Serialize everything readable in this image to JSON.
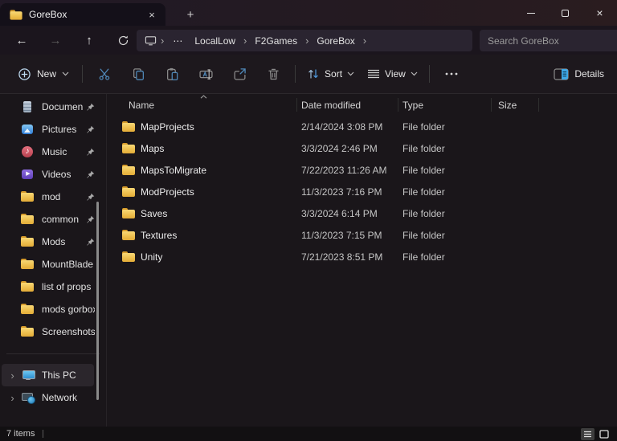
{
  "titlebar": {
    "tab_label": "GoreBox",
    "close_icon": "×",
    "new_tab_icon": "+"
  },
  "nav": {
    "back_icon": "←",
    "forward_icon": "→",
    "up_icon": "↑"
  },
  "breadcrumb": {
    "chevron": "›",
    "overflow": "⋯",
    "items": [
      {
        "label": "LocalLow"
      },
      {
        "label": "F2Games"
      },
      {
        "label": "GoreBox"
      }
    ]
  },
  "search": {
    "placeholder": "Search GoreBox"
  },
  "toolbar": {
    "new_label": "New",
    "sort_label": "Sort",
    "view_label": "View",
    "details_label": "Details"
  },
  "columns": {
    "headers": [
      {
        "label": "Name"
      },
      {
        "label": "Date modified"
      },
      {
        "label": "Type"
      },
      {
        "label": "Size"
      }
    ]
  },
  "files": {
    "rows": [
      {
        "name": "MapProjects",
        "date": "2/14/2024 3:08 PM",
        "type": "File folder",
        "size": ""
      },
      {
        "name": "Maps",
        "date": "3/3/2024 2:46 PM",
        "type": "File folder",
        "size": ""
      },
      {
        "name": "MapsToMigrate",
        "date": "7/22/2023 11:26 AM",
        "type": "File folder",
        "size": ""
      },
      {
        "name": "ModProjects",
        "date": "11/3/2023 7:16 PM",
        "type": "File folder",
        "size": ""
      },
      {
        "name": "Saves",
        "date": "3/3/2024 6:14 PM",
        "type": "File folder",
        "size": ""
      },
      {
        "name": "Textures",
        "date": "11/3/2023 7:15 PM",
        "type": "File folder",
        "size": ""
      },
      {
        "name": "Unity",
        "date": "7/21/2023 8:51 PM",
        "type": "File folder",
        "size": ""
      }
    ]
  },
  "sidebar": {
    "items": [
      {
        "label": "Documents",
        "icon": "documents",
        "pin": "pinned"
      },
      {
        "label": "Pictures",
        "icon": "pictures",
        "pin": "pinned"
      },
      {
        "label": "Music",
        "icon": "music",
        "pin": "pinned"
      },
      {
        "label": "Videos",
        "icon": "videos",
        "pin": "pinned"
      },
      {
        "label": "mod",
        "icon": "folder",
        "pin": "pinned"
      },
      {
        "label": "common",
        "icon": "folder",
        "pin": "pinned"
      },
      {
        "label": "Mods",
        "icon": "folder",
        "pin": "pinned"
      },
      {
        "label": "MountBlade Wa",
        "icon": "folder",
        "pin": "unpinned"
      },
      {
        "label": "list of props",
        "icon": "folder",
        "pin": "unpinned"
      },
      {
        "label": "mods gorbox",
        "icon": "folder",
        "pin": "unpinned"
      },
      {
        "label": "Screenshots",
        "icon": "folder",
        "pin": "unpinned"
      }
    ],
    "tree": [
      {
        "label": "This PC",
        "icon": "thispc",
        "state": "selected",
        "chevron": "›"
      },
      {
        "label": "Network",
        "icon": "network",
        "state": "normal",
        "chevron": "›"
      }
    ]
  },
  "status": {
    "count": "7 items"
  },
  "colors": {
    "accent_blue": "#4f9be0",
    "folder_yellow": "#eec04f",
    "selection": "#2b262c"
  }
}
